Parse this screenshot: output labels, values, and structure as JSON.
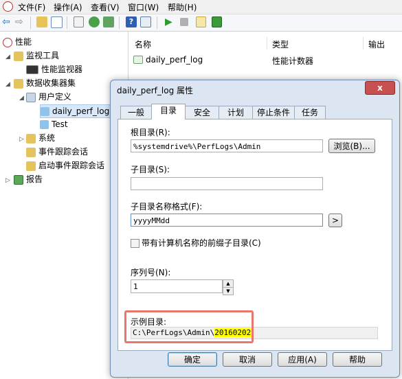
{
  "menu": [
    "文件(F)",
    "操作(A)",
    "查看(V)",
    "窗口(W)",
    "帮助(H)"
  ],
  "tree": {
    "root": "性能",
    "monitoring_tools": "监视工具",
    "perf_monitor": "性能监视器",
    "data_collector_sets": "数据收集器集",
    "user_defined": "用户定义",
    "daily_perf_log": "daily_perf_log",
    "test": "Test",
    "system": "系统",
    "event_trace": "事件跟踪会话",
    "startup_event_trace": "启动事件跟踪会话",
    "reports": "报告"
  },
  "list": {
    "columns": [
      "名称",
      "类型",
      "输出"
    ],
    "rows": [
      {
        "name": "daily_perf_log",
        "type": "性能计数器"
      }
    ]
  },
  "dialog": {
    "title": "daily_perf_log 属性",
    "close": "x",
    "tabs": [
      "一般",
      "目录",
      "安全",
      "计划",
      "停止条件",
      "任务"
    ],
    "root_dir_label": "根目录(R):",
    "root_dir_value": "%systemdrive%\\PerfLogs\\Admin",
    "browse": "浏览(B)...",
    "subdir_label": "子目录(S):",
    "subdir_value": "",
    "subdir_format_label": "子目录名称格式(F):",
    "subdir_format_value": "yyyyMMdd",
    "arrow_btn": ">",
    "prefix_checkbox": "带有计算机名称的前缀子目录(C)",
    "serial_label": "序列号(N):",
    "serial_value": "1",
    "example_label": "示例目录:",
    "example_path": "C:\\PerfLogs\\Admin\\",
    "example_date": "20160202",
    "ok": "确定",
    "cancel": "取消",
    "apply": "应用(A)",
    "help": "帮助"
  },
  "colors": {
    "highlight_border": "#e8766b",
    "highlight_fill": "#ffff00",
    "dialog_frame": "#dce6f2"
  },
  "icons": [
    "back-icon",
    "forward-icon",
    "up-icon",
    "show-hide-tree-icon",
    "properties-icon",
    "refresh-icon",
    "export-icon",
    "help-icon",
    "action-pane-icon",
    "start-icon",
    "stop-icon",
    "new-icon",
    "save-icon"
  ]
}
